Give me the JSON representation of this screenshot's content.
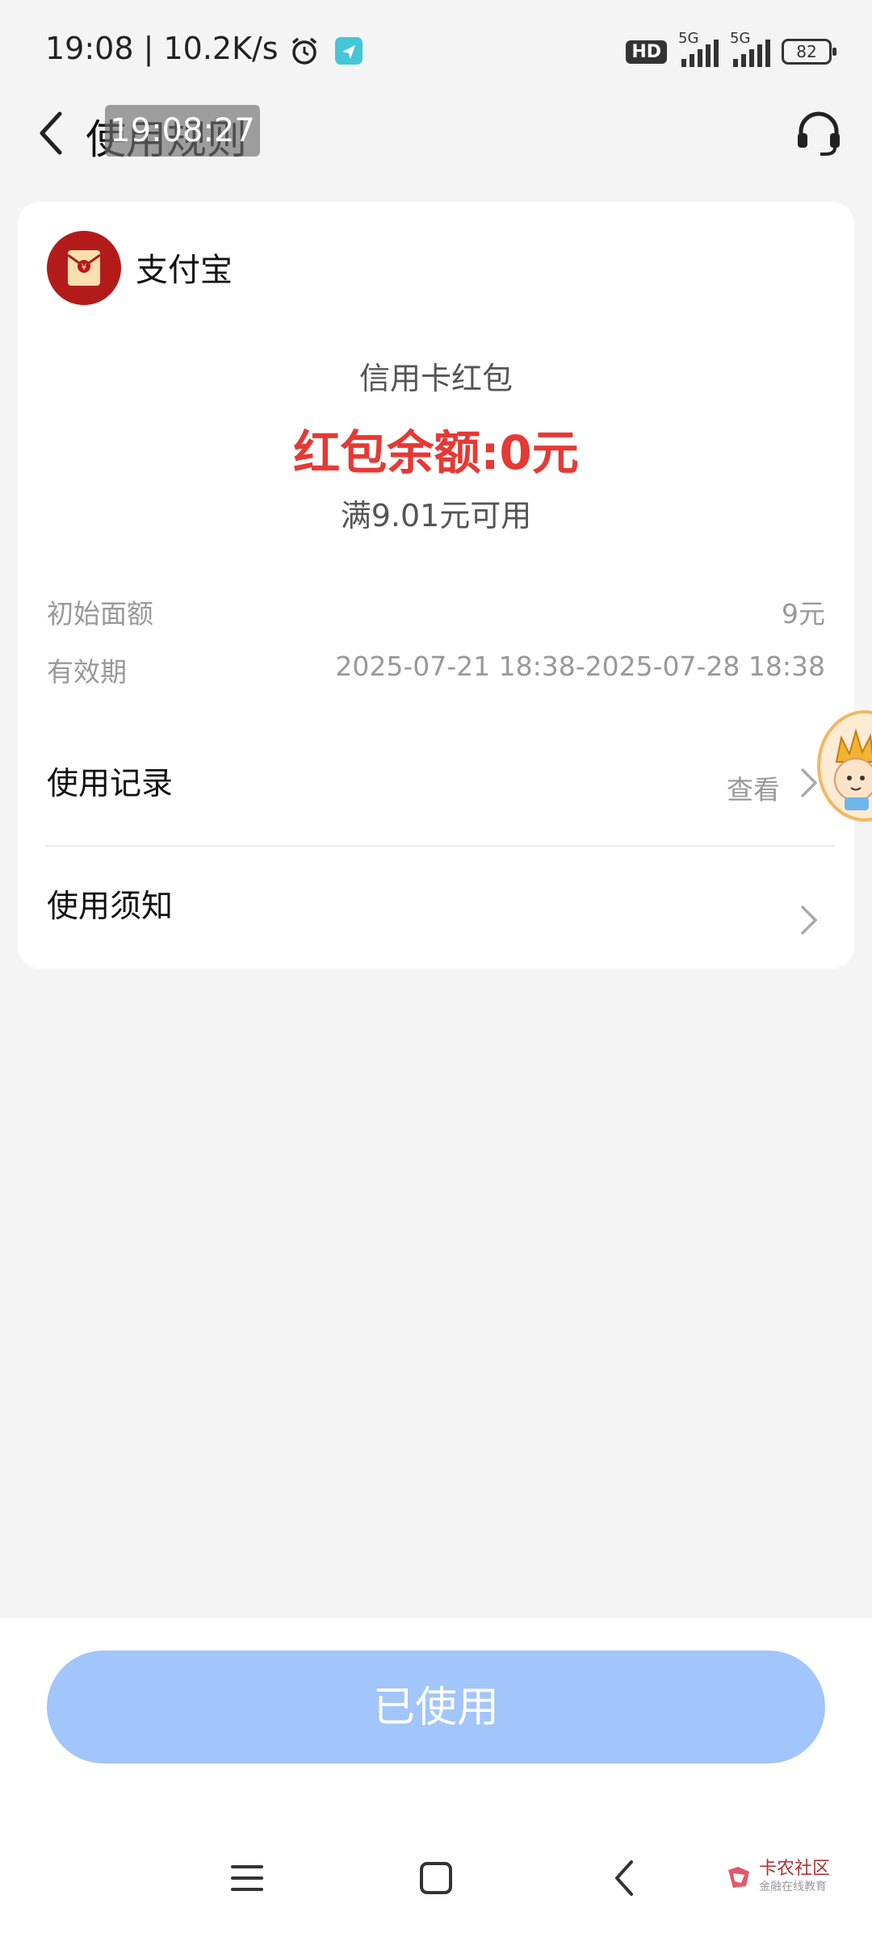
{
  "status_bar": {
    "time": "19:08 | 10.2K/s",
    "hd": "HD",
    "sim1": "5G",
    "sim2": "5G",
    "battery": "82"
  },
  "header": {
    "title": "使用规则",
    "overlay_time": "19:08:27"
  },
  "card": {
    "brand_name": "支付宝",
    "coupon_type": "信用卡红包",
    "balance": "红包余额:0元",
    "condition": "满9.01元可用",
    "rows": [
      {
        "label": "初始面额",
        "value": "9元"
      },
      {
        "label": "有效期",
        "value": "2025-07-21 18:38-2025-07-28 18:38"
      }
    ],
    "usage_record": {
      "label": "使用记录",
      "link": "查看"
    },
    "usage_notes": {
      "label": "使用须知"
    }
  },
  "bottom": {
    "button_label": "已使用"
  },
  "watermark": {
    "title": "卡农社区",
    "subtitle": "金融在线教育"
  },
  "colors": {
    "accent_red": "#e53935",
    "button_blue": "#a2c5fb",
    "background": "#f4f4f4"
  },
  "icons": [
    "back-arrow-icon",
    "headset-icon",
    "red-envelope-icon",
    "chevron-right-icon",
    "menu-icon",
    "home-icon",
    "back-icon",
    "alarm-icon",
    "location-icon"
  ]
}
